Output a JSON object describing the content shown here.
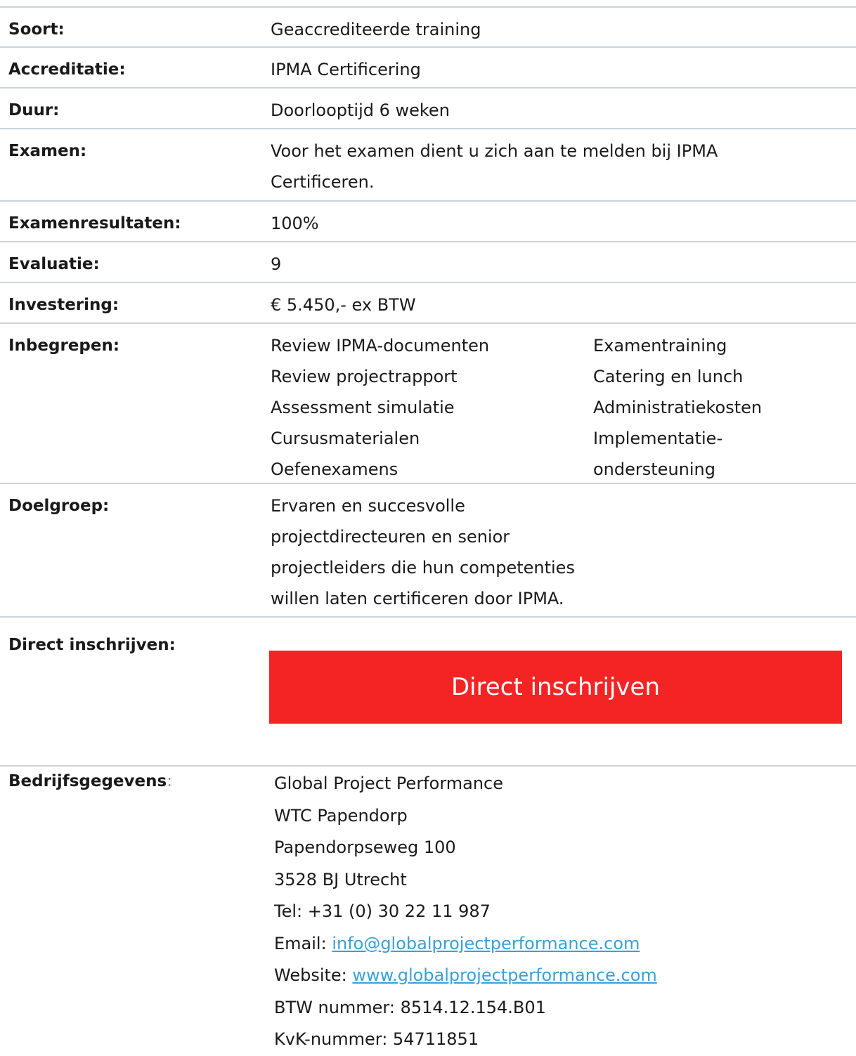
{
  "details": {
    "soort": {
      "label": "Soort:",
      "value": "Geaccrediteerde training"
    },
    "accreditatie": {
      "label": "Accreditatie:",
      "value": "IPMA Certificering"
    },
    "duur": {
      "label": "Duur:",
      "value": "Doorlooptijd 6 weken"
    },
    "examen": {
      "label": "Examen:",
      "value_line1": "Voor het examen dient u zich aan te melden bij IPMA",
      "value_line2": "Certificeren."
    },
    "examenresultaten": {
      "label": "Examenresultaten:",
      "value": "100%"
    },
    "evaluatie": {
      "label": "Evaluatie:",
      "value": "9"
    },
    "investering": {
      "label": "Investering:",
      "value": "€ 5.450,- ex BTW"
    },
    "inbegrepen": {
      "label": "Inbegrepen:",
      "col1": [
        "Review IPMA-documenten",
        "Review projectrapport",
        "Assessment simulatie",
        "Cursusmaterialen",
        "Oefenexamens"
      ],
      "col2": [
        "Examentraining",
        "Catering en lunch",
        "Administratiekosten",
        "Implementatie-",
        "ondersteuning"
      ]
    },
    "doelgroep": {
      "label": "Doelgroep:",
      "lines": [
        "Ervaren en succesvolle",
        "projectdirecteuren en senior",
        "projectleiders die hun competenties",
        "willen laten certificeren door IPMA."
      ]
    }
  },
  "direct": {
    "label": "Direct inschrijven:",
    "button_label": "Direct inschrijven",
    "button_color": "#f42324"
  },
  "company": {
    "label": "Bedrijfsgegevens",
    "label_suffix": ":",
    "name": "Global Project Performance",
    "building": "WTC Papendorp",
    "street": "Papendorpseweg 100",
    "city": "3528 BJ Utrecht",
    "tel": "Tel: +31 (0) 30 22 11 987",
    "email_prefix": "Email: ",
    "email": "info@globalprojectperformance.com",
    "website_prefix": "Website: ",
    "website": "www.globalprojectperformance.com",
    "btw": "BTW nummer: 8514.12.154.B01",
    "kvk": "KvK-nummer: 54711851"
  },
  "colors": {
    "divider": "#c9d3dc",
    "link": "#3aa0d6"
  }
}
